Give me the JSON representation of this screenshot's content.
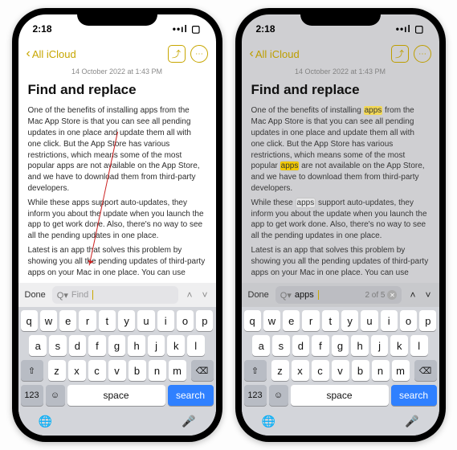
{
  "status": {
    "time": "2:18",
    "indicators": "••ıl ▢"
  },
  "nav": {
    "back": "All iCloud"
  },
  "note": {
    "timestamp": "14 October 2022 at 1:43 PM",
    "title": "Find and replace",
    "para1_a": "One of the benefits of installing ",
    "para1_b": " from the Mac App Store is that you can see all pending updates in one place and update them all with one click. But the App Store has various restrictions, which means some of the most popular ",
    "para1_c": " are not available on the App Store, and we have to download them from third-party developers.",
    "para2_a": "While these ",
    "para2_b": " support auto-updates, they inform you about the update when you launch the app to get work done. Also, there's no way to see all the pending updates in one place.",
    "para3": "Latest is an app that solves this problem by showing you all the pending updates of third-party apps on your Mac in one place. You can use",
    "word_apps": "apps"
  },
  "findbar": {
    "done": "Done",
    "placeholder": "Find",
    "query": "apps",
    "count": "2 of 5"
  },
  "keyboard": {
    "row1": [
      "q",
      "w",
      "e",
      "r",
      "t",
      "y",
      "u",
      "i",
      "o",
      "p"
    ],
    "row2": [
      "a",
      "s",
      "d",
      "f",
      "g",
      "h",
      "j",
      "k",
      "l"
    ],
    "row3": [
      "z",
      "x",
      "c",
      "v",
      "b",
      "n",
      "m"
    ],
    "shift": "⇧",
    "bksp": "⌫",
    "numkey": "123",
    "emoji": "☺",
    "space": "space",
    "search": "search",
    "globe": "🌐",
    "mic": "🎤"
  }
}
